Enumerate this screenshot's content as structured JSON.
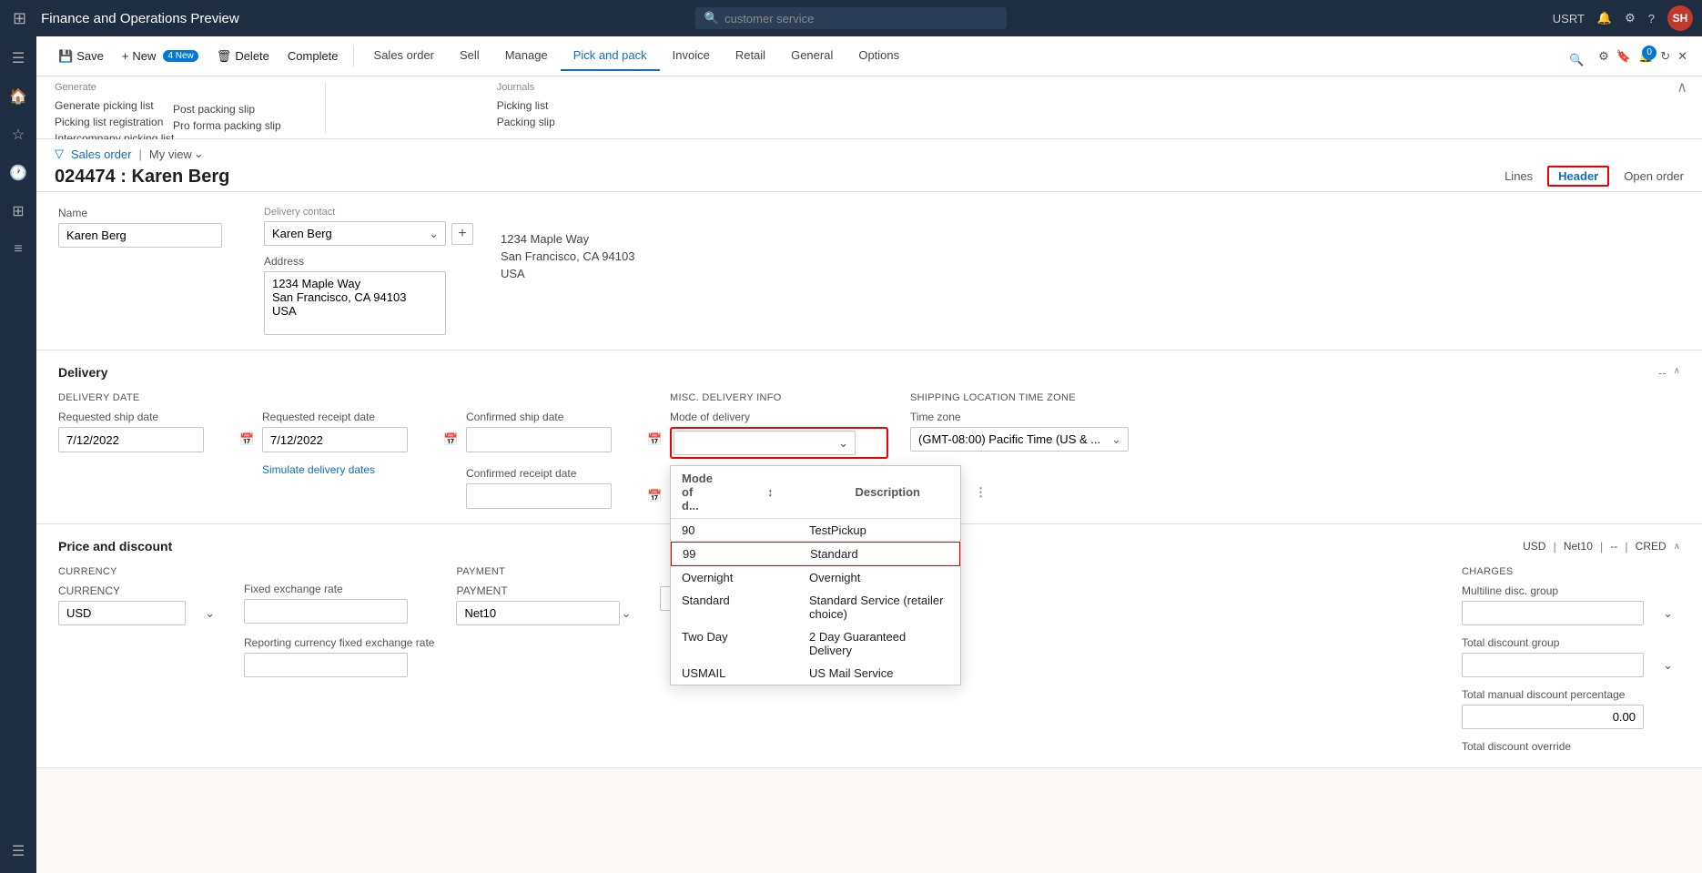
{
  "app": {
    "title": "Finance and Operations Preview",
    "search_placeholder": "customer service"
  },
  "topnav": {
    "user_initials": "SH",
    "username": "USRT",
    "icons": [
      "bell",
      "gear",
      "help"
    ]
  },
  "sidebar": {
    "icons": [
      "home",
      "star",
      "clock",
      "grid",
      "list",
      "menu"
    ]
  },
  "command_bar": {
    "buttons": [
      {
        "id": "save",
        "label": "Save",
        "icon": "💾"
      },
      {
        "id": "new",
        "label": "New",
        "icon": "+"
      },
      {
        "id": "delete",
        "label": "Delete",
        "icon": "🗑"
      },
      {
        "id": "complete",
        "label": "Complete",
        "icon": ""
      }
    ]
  },
  "tabs": {
    "items": [
      {
        "id": "sales-order",
        "label": "Sales order"
      },
      {
        "id": "sell",
        "label": "Sell"
      },
      {
        "id": "manage",
        "label": "Manage"
      },
      {
        "id": "pick-and-pack",
        "label": "Pick and pack",
        "active": true
      },
      {
        "id": "invoice",
        "label": "Invoice"
      },
      {
        "id": "retail",
        "label": "Retail"
      },
      {
        "id": "general",
        "label": "General"
      },
      {
        "id": "options",
        "label": "Options"
      }
    ]
  },
  "ribbon": {
    "groups": [
      {
        "id": "generate",
        "label": "Generate",
        "links": [
          "Generate picking list",
          "Picking list registration",
          "Intercompany picking list",
          "Post packing slip",
          "Pro forma packing slip"
        ]
      },
      {
        "id": "journals",
        "label": "Journals",
        "links": [
          "Picking list",
          "Packing slip"
        ]
      }
    ]
  },
  "breadcrumb": {
    "link": "Sales order",
    "view": "My view"
  },
  "page": {
    "title": "024474 : Karen Berg",
    "lines_label": "Lines",
    "header_label": "Header",
    "open_order_label": "Open order"
  },
  "customer_section": {
    "delivery_contact_label": "Delivery contact",
    "name_label": "Name",
    "name_value": "Karen Berg",
    "customer_label": "Karen Berg",
    "address_label": "Address",
    "address_line1": "1234 Maple Way",
    "address_line2": "San Francisco, CA 94103",
    "address_line3": "USA"
  },
  "delivery_section": {
    "title": "Delivery",
    "delivery_date_label": "DELIVERY DATE",
    "requested_ship_date_label": "Requested ship date",
    "requested_ship_date_value": "7/12/2022",
    "requested_receipt_date_label": "Requested receipt date",
    "requested_receipt_date_value": "7/12/2022",
    "simulate_delivery_dates_label": "Simulate delivery dates",
    "confirmed_ship_date_label": "Confirmed ship date",
    "confirmed_ship_date_value": "",
    "confirmed_receipt_date_label": "Confirmed receipt date",
    "confirmed_receipt_date_value": "",
    "misc_delivery_info_label": "MISC. DELIVERY INFO",
    "mode_of_delivery_label": "Mode of delivery",
    "mode_of_delivery_value": "",
    "shipping_location_tz_label": "SHIPPING LOCATION TIME ZONE",
    "time_zone_label": "Time zone",
    "time_zone_value": "(GMT-08:00) Pacific Time (US & ..."
  },
  "mode_delivery_dropdown": {
    "col1_header": "Mode of d...",
    "col2_header": "Description",
    "rows": [
      {
        "code": "90",
        "description": "TestPickup",
        "selected": false
      },
      {
        "code": "99",
        "description": "Standard",
        "selected": true
      },
      {
        "code": "Overnight",
        "description": "Overnight",
        "selected": false
      },
      {
        "code": "Standard",
        "description": "Standard Service (retailer choice)",
        "selected": false
      },
      {
        "code": "Two Day",
        "description": "2 Day Guaranteed Delivery",
        "selected": false
      },
      {
        "code": "USMAIL",
        "description": "US Mail Service",
        "selected": false
      }
    ]
  },
  "price_section": {
    "title": "Price and discount",
    "meta_tags": [
      "USD",
      "Net10",
      "--",
      "CRED"
    ],
    "currency_label": "CURRENCY",
    "currency_value": "USD",
    "fixed_exchange_rate_label": "Fixed exchange rate",
    "fixed_exchange_rate_value": "",
    "reporting_currency_label": "Reporting currency fixed exchange rate",
    "reporting_currency_value": "",
    "payment_label": "PAYMENT",
    "payment_value": "Net10",
    "charges_label": "CHARGES",
    "multiline_disc_group_label": "Multiline disc. group",
    "multiline_disc_group_value": "",
    "total_discount_group_label": "Total discount group",
    "total_discount_group_value": "",
    "total_manual_discount_label": "Total manual discount percentage",
    "total_manual_discount_value": "0.00",
    "total_discount_override_label": "Total discount override"
  },
  "new_badge": "4 New",
  "complete_badge": "Complete"
}
